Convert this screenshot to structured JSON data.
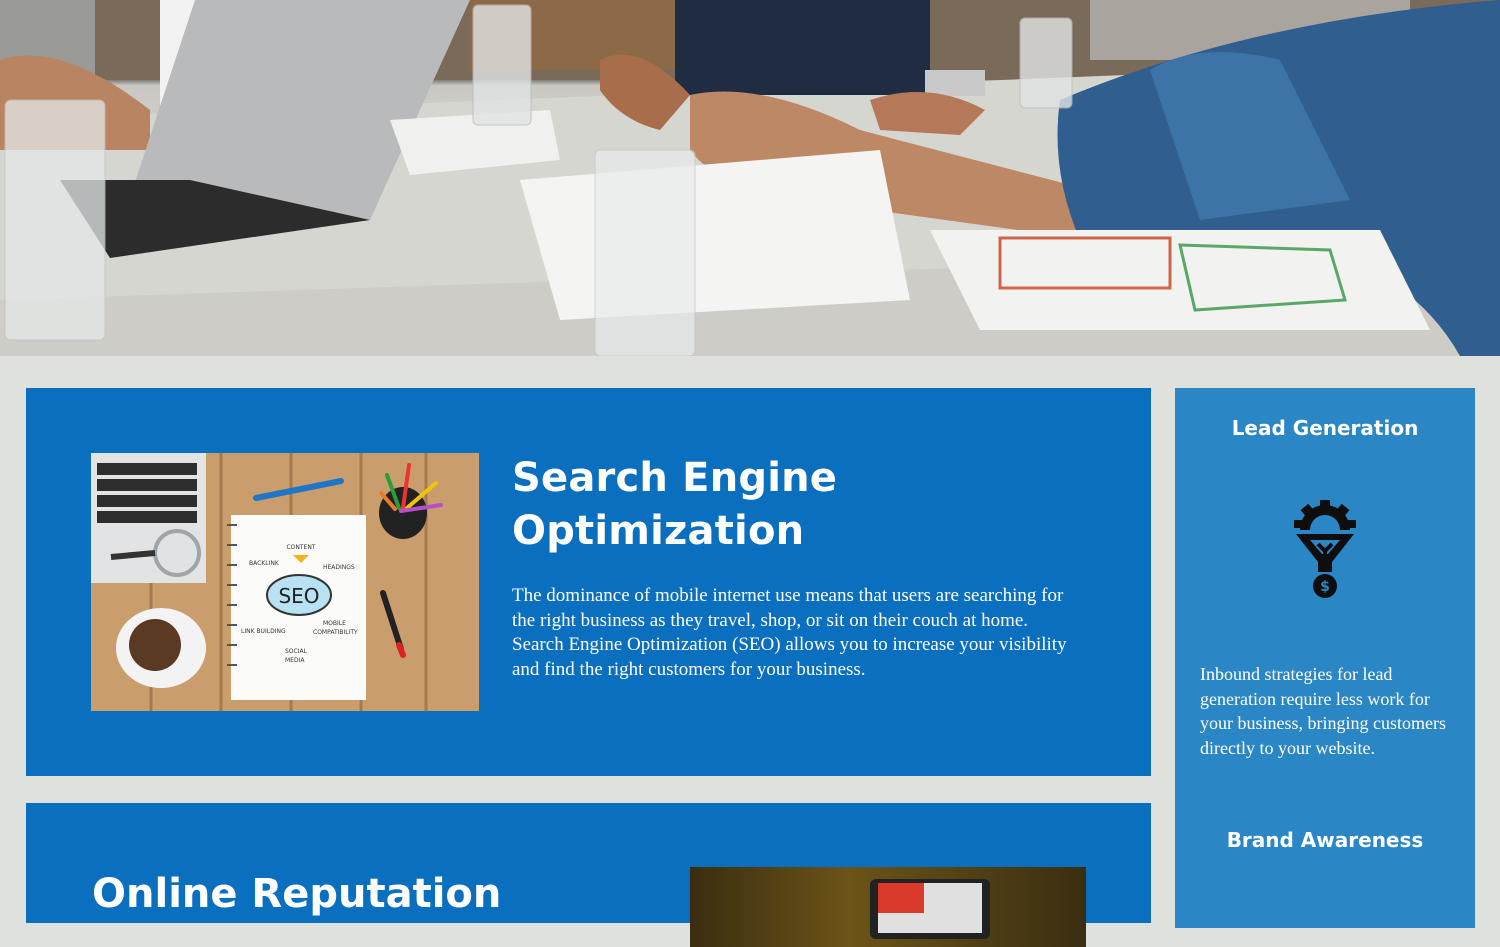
{
  "hero": {
    "image_alt": "Team meeting around a table with laptop, documents and glasses of water"
  },
  "seo_card": {
    "title": "Search Engine Optimization",
    "body": "The dominance of mobile internet use means that users are searching for the right business as they travel, shop, or sit on their couch at home. Search Engine Optimization (SEO) allows you to increase your visibility and find the right customers for your business.",
    "image_labels": {
      "center": "SEO",
      "content": "CONTENT",
      "backlink": "BACKLINK",
      "headings": "HEADINGS",
      "link_building": "LINK BUILDING",
      "mobile": "MOBILE",
      "compatibility": "COMPATIBILITY",
      "social": "SOCIAL",
      "media": "MEDIA"
    }
  },
  "reputation_card": {
    "title": "Online Reputation"
  },
  "sidebar": {
    "lead_heading": "Lead Generation",
    "lead_icon": "funnel-gear-dollar-icon",
    "lead_text": "Inbound strategies for lead generation require less work for your business, bringing customers directly to your website.",
    "brand_heading": "Brand Awareness"
  },
  "colors": {
    "page_background": "#dfe1dc",
    "card_blue": "#0b6fc0",
    "sidebar_blue": "#2b86c5",
    "text": "#ffffff"
  }
}
